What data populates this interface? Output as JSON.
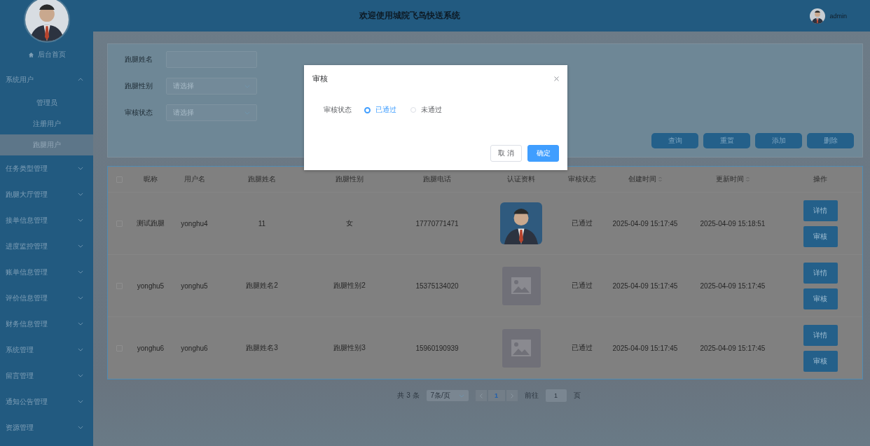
{
  "header": {
    "title": "欢迎使用城院飞鸟快送系统",
    "user": "admin"
  },
  "sidebar": {
    "items": [
      {
        "kind": "home",
        "label": "后台首页"
      },
      {
        "kind": "group",
        "label": "系统用户",
        "expanded": true,
        "children": [
          {
            "label": "管理员",
            "selected": false
          },
          {
            "label": "注册用户",
            "selected": false
          },
          {
            "label": "跑腿用户",
            "selected": true
          }
        ]
      },
      {
        "kind": "group",
        "label": "任务类型管理",
        "expanded": false
      },
      {
        "kind": "group",
        "label": "跑腿大厅管理",
        "expanded": false
      },
      {
        "kind": "group",
        "label": "接单信息管理",
        "expanded": false
      },
      {
        "kind": "group",
        "label": "进度监控管理",
        "expanded": false
      },
      {
        "kind": "group",
        "label": "账单信息管理",
        "expanded": false
      },
      {
        "kind": "group",
        "label": "评价信息管理",
        "expanded": false
      },
      {
        "kind": "group",
        "label": "财务信息管理",
        "expanded": false
      },
      {
        "kind": "group",
        "label": "系统管理",
        "expanded": false
      },
      {
        "kind": "group",
        "label": "留言管理",
        "expanded": false
      },
      {
        "kind": "group",
        "label": "通知公告管理",
        "expanded": false
      },
      {
        "kind": "group",
        "label": "资源管理",
        "expanded": false
      }
    ]
  },
  "search": {
    "fields": [
      {
        "kind": "input",
        "label": "跑腿姓名"
      },
      {
        "kind": "select",
        "label": "跑腿性别",
        "placeholder": "请选择"
      },
      {
        "kind": "select",
        "label": "审核状态",
        "placeholder": "请选择"
      }
    ],
    "buttons": [
      "查询",
      "重置",
      "添加",
      "删除"
    ]
  },
  "table": {
    "all_checked": false,
    "columns": [
      {
        "label": "昵称",
        "sortable": false
      },
      {
        "label": "用户名",
        "sortable": false
      },
      {
        "label": "跑腿姓名",
        "sortable": false
      },
      {
        "label": "跑腿性别",
        "sortable": false
      },
      {
        "label": "跑腿电话",
        "sortable": false
      },
      {
        "label": "认证资料",
        "sortable": false
      },
      {
        "label": "审核状态",
        "sortable": false
      },
      {
        "label": "创建时间",
        "sortable": true
      },
      {
        "label": "更新时间",
        "sortable": true
      },
      {
        "label": "操作",
        "sortable": false
      }
    ],
    "rows": [
      {
        "checked": false,
        "nickname": "测试跑腿",
        "username": "yonghu4",
        "name": "11",
        "gender": "女",
        "phone": "17770771471",
        "photo": {
          "kind": "picture"
        },
        "status": "已通过",
        "created": "2025-04-09 15:17:45",
        "updated": "2025-04-09 15:18:51",
        "actions": [
          "详情",
          "审核"
        ]
      },
      {
        "checked": false,
        "nickname": "yonghu5",
        "username": "yonghu5",
        "name": "跑腿姓名2",
        "gender": "跑腿性别2",
        "phone": "15375134020",
        "photo": {
          "kind": "placeholder"
        },
        "status": "已通过",
        "created": "2025-04-09 15:17:45",
        "updated": "2025-04-09 15:17:45",
        "actions": [
          "详情",
          "审核"
        ]
      },
      {
        "checked": false,
        "nickname": "yonghu6",
        "username": "yonghu6",
        "name": "跑腿姓名3",
        "gender": "跑腿性别3",
        "phone": "15960190939",
        "photo": {
          "kind": "placeholder"
        },
        "status": "已通过",
        "created": "2025-04-09 15:17:45",
        "updated": "2025-04-09 15:17:45",
        "actions": [
          "详情",
          "审核"
        ]
      }
    ]
  },
  "pagination": {
    "total": "共 3 条",
    "page_size": "7条/页",
    "pages": [
      {
        "label": "1",
        "selected": true
      }
    ],
    "goto_label": "前往",
    "goto_value": "1",
    "goto_suffix": "页"
  },
  "dialog": {
    "title": "审核",
    "field_label": "审核状态",
    "options": [
      {
        "label": "已通过",
        "selected": true
      },
      {
        "label": "未通过",
        "selected": false
      }
    ],
    "buttons": [
      {
        "kind": "default",
        "label": "取 消"
      },
      {
        "kind": "primary",
        "label": "确定"
      }
    ]
  }
}
